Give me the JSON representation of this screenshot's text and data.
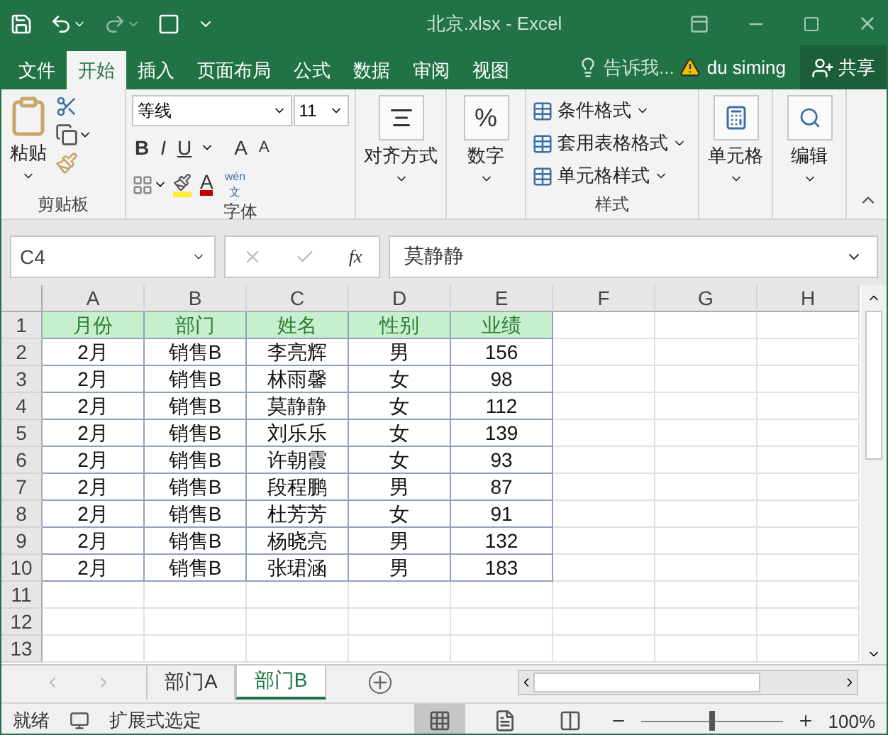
{
  "window": {
    "title": "北京.xlsx - Excel"
  },
  "menu_tabs": [
    {
      "label": "文件",
      "selected": false
    },
    {
      "label": "开始",
      "selected": true
    },
    {
      "label": "插入",
      "selected": false
    },
    {
      "label": "页面布局",
      "selected": false
    },
    {
      "label": "公式",
      "selected": false
    },
    {
      "label": "数据",
      "selected": false
    },
    {
      "label": "审阅",
      "selected": false
    },
    {
      "label": "视图",
      "selected": false
    }
  ],
  "tell_me": "告诉我...",
  "user": "du siming",
  "share": "共享",
  "ribbon": {
    "clipboard": {
      "paste": "粘贴",
      "label": "剪贴板"
    },
    "font": {
      "name": "等线",
      "size": "11",
      "bold": "B",
      "italic": "I",
      "underline": "U",
      "grow": "A",
      "shrink": "A",
      "color_letter": "A",
      "pinyin": "wén",
      "pinyin_char": "文",
      "label": "字体"
    },
    "alignment": "对齐方式",
    "number": {
      "symbol": "%",
      "label": "数字"
    },
    "styles": {
      "items": [
        "条件格式",
        "套用表格格式",
        "单元格样式"
      ],
      "label": "样式"
    },
    "cells": "单元格",
    "editing": "编辑"
  },
  "formula_bar": {
    "name_box": "C4",
    "fx": "fx",
    "formula": "莫静静"
  },
  "columns": [
    "A",
    "B",
    "C",
    "D",
    "E",
    "F",
    "G",
    "H"
  ],
  "rows": [
    {
      "number": "1",
      "kind": "header",
      "cells": [
        "月份",
        "部门",
        "姓名",
        "性别",
        "业绩"
      ]
    },
    {
      "number": "2",
      "kind": "data",
      "cells": [
        "2月",
        "销售B",
        "李亮辉",
        "男",
        "156"
      ]
    },
    {
      "number": "3",
      "kind": "data",
      "cells": [
        "2月",
        "销售B",
        "林雨馨",
        "女",
        "98"
      ]
    },
    {
      "number": "4",
      "kind": "data",
      "cells": [
        "2月",
        "销售B",
        "莫静静",
        "女",
        "112"
      ]
    },
    {
      "number": "5",
      "kind": "data",
      "cells": [
        "2月",
        "销售B",
        "刘乐乐",
        "女",
        "139"
      ]
    },
    {
      "number": "6",
      "kind": "data",
      "cells": [
        "2月",
        "销售B",
        "许朝霞",
        "女",
        "93"
      ]
    },
    {
      "number": "7",
      "kind": "data",
      "cells": [
        "2月",
        "销售B",
        "段程鹏",
        "男",
        "87"
      ]
    },
    {
      "number": "8",
      "kind": "data",
      "cells": [
        "2月",
        "销售B",
        "杜芳芳",
        "女",
        "91"
      ]
    },
    {
      "number": "9",
      "kind": "data",
      "cells": [
        "2月",
        "销售B",
        "杨晓亮",
        "男",
        "132"
      ]
    },
    {
      "number": "10",
      "kind": "data",
      "cells": [
        "2月",
        "销售B",
        "张珺涵",
        "男",
        "183"
      ]
    },
    {
      "number": "11",
      "kind": "empty",
      "cells": []
    },
    {
      "number": "12",
      "kind": "empty",
      "cells": []
    },
    {
      "number": "13",
      "kind": "empty",
      "cells": []
    }
  ],
  "sheet_tabs": [
    {
      "label": "部门A",
      "selected": false
    },
    {
      "label": "部门B",
      "selected": true
    }
  ],
  "status_bar": {
    "ready": "就绪",
    "mode": "扩展式选定",
    "view_modes": [
      {
        "kind": "normal",
        "selected": true
      },
      {
        "kind": "layout",
        "selected": false
      },
      {
        "kind": "break",
        "selected": false
      }
    ],
    "zoom": {
      "level": 0.5,
      "text": "100%"
    }
  }
}
